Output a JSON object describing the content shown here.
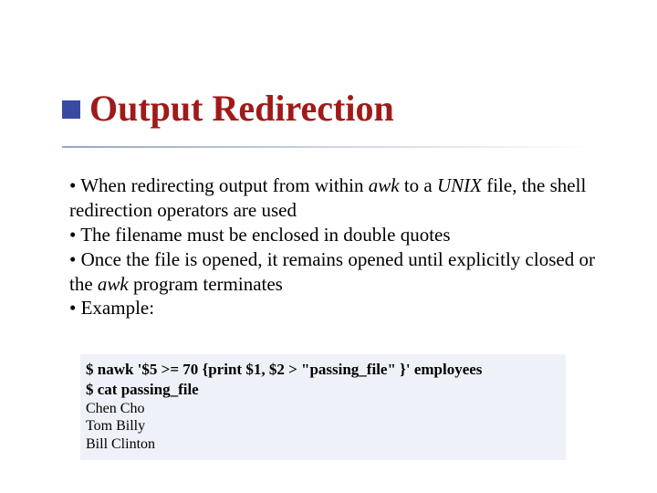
{
  "title": "Output Redirection",
  "bullets": {
    "b1_pre": "When redirecting output from within ",
    "b1_awk": "awk",
    "b1_mid": " to a ",
    "b1_unix": "UNIX",
    "b1_post": " file, the shell redirection operators are used",
    "b2": "The filename must be enclosed in double quotes",
    "b3_pre": "Once the file is opened, it remains opened until explicitly closed or the ",
    "b3_awk": "awk",
    "b3_post": " program terminates",
    "b4": "Example:"
  },
  "code": {
    "line1": "$ nawk '$5 >= 70 {print $1, $2 > \"passing_file\" }' employees",
    "line2": "$ cat passing_file",
    "out1": "Chen Cho",
    "out2": "Tom Billy",
    "out3": "Bill Clinton"
  }
}
